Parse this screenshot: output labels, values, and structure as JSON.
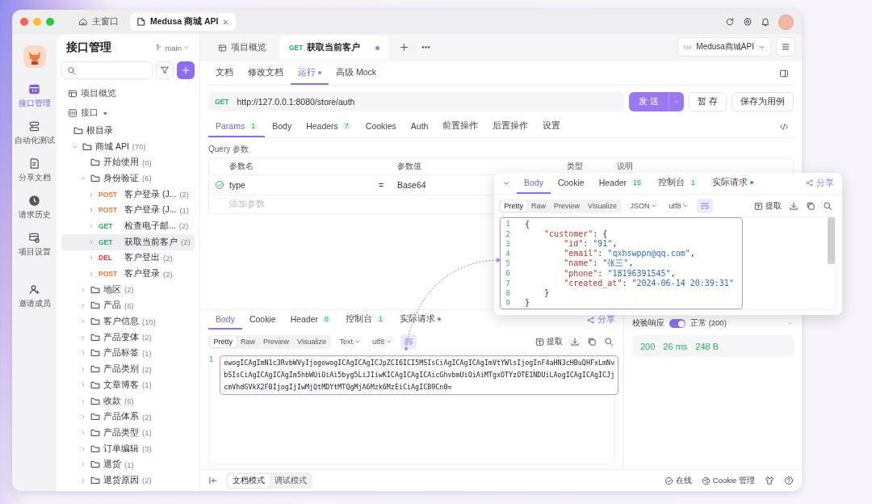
{
  "titlebar": {
    "tabs": [
      {
        "kind": "home",
        "label": "主窗口",
        "selected": false
      },
      {
        "kind": "project",
        "label": "Medusa 商城 API",
        "selected": true
      }
    ]
  },
  "rail": {
    "items": [
      {
        "kind": "api",
        "label": "接口管理",
        "selected": true
      },
      {
        "kind": "test",
        "label": "自动化测试",
        "selected": false
      },
      {
        "kind": "doc",
        "label": "分享文档",
        "selected": false
      },
      {
        "kind": "history",
        "label": "请求历史",
        "selected": false
      },
      {
        "kind": "settings",
        "label": "项目设置",
        "selected": false
      },
      {
        "kind": "invite",
        "label": "邀请成员",
        "selected": false
      }
    ]
  },
  "sidebar": {
    "title": "接口管理",
    "branch": "main",
    "overview": "项目概览",
    "section": "接口",
    "tree": [
      {
        "kind": "root",
        "label": "根目录",
        "selected": false
      },
      {
        "kind": "folder",
        "label": "商城 API",
        "count": "(70)",
        "expanded": true,
        "selected": false,
        "children": [
          {
            "kind": "plain-folder",
            "label": "开始使用",
            "count": "(0)",
            "selected": false
          },
          {
            "kind": "folder",
            "label": "身份验证",
            "count": "(6)",
            "expanded": true,
            "selected": false,
            "children": [
              {
                "kind": "endpoint",
                "method": "POST",
                "color": "#f5782f",
                "label": "客户登录 (J...",
                "count": "(2)",
                "expanded": false,
                "selected": false
              },
              {
                "kind": "endpoint",
                "method": "POST",
                "color": "#f5782f",
                "label": "客户登录 (J...",
                "count": "(1)",
                "expanded": false,
                "selected": false
              },
              {
                "kind": "endpoint",
                "method": "GET",
                "color": "#22b35e",
                "label": "检查电子邮...",
                "count": "(2)",
                "expanded": false,
                "selected": false
              },
              {
                "kind": "endpoint",
                "method": "GET",
                "color": "#22b35e",
                "label": "获取当前客户",
                "count": "(2)",
                "expanded": false,
                "selected": true
              },
              {
                "kind": "endpoint",
                "method": "DEL",
                "color": "#ee3b3b",
                "label": "客户登出",
                "count": "(2)",
                "expanded": false,
                "selected": false
              },
              {
                "kind": "endpoint",
                "method": "POST",
                "color": "#f5782f",
                "label": "客户登录",
                "count": "(2)",
                "expanded": false,
                "selected": false
              }
            ]
          },
          {
            "kind": "folder",
            "label": "地区",
            "count": "(2)",
            "expanded": false,
            "selected": false
          },
          {
            "kind": "folder",
            "label": "产品",
            "count": "(6)",
            "expanded": false,
            "selected": false
          },
          {
            "kind": "folder",
            "label": "客户信息",
            "count": "(10)",
            "expanded": false,
            "selected": false
          },
          {
            "kind": "folder",
            "label": "产品变体",
            "count": "(2)",
            "expanded": false,
            "selected": false
          },
          {
            "kind": "folder",
            "label": "产品标签",
            "count": "(1)",
            "expanded": false,
            "selected": false
          },
          {
            "kind": "folder",
            "label": "产品类别",
            "count": "(2)",
            "expanded": false,
            "selected": false
          },
          {
            "kind": "folder",
            "label": "文章博客",
            "count": "(1)",
            "expanded": false,
            "selected": false
          },
          {
            "kind": "folder",
            "label": "收款",
            "count": "(6)",
            "expanded": false,
            "selected": false
          },
          {
            "kind": "folder",
            "label": "产品体系",
            "count": "(2)",
            "expanded": false,
            "selected": false
          },
          {
            "kind": "folder",
            "label": "产品类型",
            "count": "(1)",
            "expanded": false,
            "selected": false
          },
          {
            "kind": "folder",
            "label": "订单编辑",
            "count": "(3)",
            "expanded": false,
            "selected": false
          },
          {
            "kind": "folder",
            "label": "退货",
            "count": "(1)",
            "expanded": false,
            "selected": false
          },
          {
            "kind": "folder",
            "label": "退货原因",
            "count": "(2)",
            "expanded": false,
            "selected": false
          }
        ]
      }
    ]
  },
  "main_tabs": [
    {
      "kind": "overview",
      "label": "项目概览",
      "selected": false,
      "unsaved": false
    },
    {
      "kind": "request",
      "method": "GET",
      "label": "获取当前客户",
      "selected": true,
      "unsaved": true
    }
  ],
  "project_switcher": {
    "badge": "Me",
    "label": "Medusa商城API"
  },
  "sub_tabs": [
    {
      "label": "文档",
      "selected": false,
      "dot": false
    },
    {
      "label": "修改文档",
      "selected": false,
      "dot": false
    },
    {
      "label": "运行",
      "selected": true,
      "dot": true
    },
    {
      "label": "高级 Mock",
      "selected": false,
      "dot": false
    }
  ],
  "request": {
    "method": "GET",
    "url": "http://127.0.0.1:8080/store/auth",
    "send": "发 送",
    "save": "暂 存",
    "save_case": "保存为用例"
  },
  "param_tabs": [
    {
      "label": "Params",
      "badge": "1",
      "selected": true
    },
    {
      "label": "Body",
      "selected": false
    },
    {
      "label": "Headers",
      "badge": "7",
      "selected": false
    },
    {
      "label": "Cookies",
      "selected": false
    },
    {
      "label": "Auth",
      "selected": false
    },
    {
      "label": "前置操作",
      "selected": false
    },
    {
      "label": "后置操作",
      "selected": false
    },
    {
      "label": "设置",
      "selected": false
    }
  ],
  "query": {
    "title": "Query 参数",
    "columns": [
      "参数名",
      "参数值",
      "类型",
      "说明"
    ],
    "rows": [
      {
        "checked": true,
        "name": "type",
        "operator": "=",
        "value": "Base64"
      }
    ],
    "placeholder": "添加参数"
  },
  "response": {
    "tabs": [
      {
        "label": "Body",
        "selected": true,
        "dot": false
      },
      {
        "label": "Cookie",
        "selected": false,
        "dot": false
      },
      {
        "label": "Header",
        "badge": "8",
        "selected": false,
        "dot": false
      },
      {
        "label": "控制台",
        "badge": "1",
        "selected": false,
        "dot": false
      },
      {
        "label": "实际请求",
        "selected": false,
        "dot": true
      }
    ],
    "share": "分享",
    "formats": [
      {
        "label": "Pretty",
        "selected": true
      },
      {
        "label": "Raw",
        "selected": false
      },
      {
        "label": "Preview",
        "selected": false
      },
      {
        "label": "Visualize",
        "selected": false
      }
    ],
    "dropdowns": [
      "Text",
      "utf8"
    ],
    "wrap": true,
    "extract": "提取",
    "highlight": true,
    "lines": [
      {
        "number": "1",
        "text": "ewogICAgImN1c3RvbWVyIjogewogICAgICAgICJpZCI6ICI5MSIsCiAgICAgICAgImVtYWlsIjogInF4aHN3cHBuQHFxLmNvbSIsCiAgICAgICAgIm5hbWUiOiAi5byg5LiJIiwKICAgICAgICAicGhvbmUiOiAiMTgxOTYzOTE1NDUiLAogICAgICAgICJjcmVhdGVkX2F0IjogIjIwMjQtMDYtMTQgMjA6Mzk6MzEiCiAgICB9Cn0="
      }
    ]
  },
  "validation": {
    "label": "校验响应",
    "on": true,
    "status": "正常 (200)",
    "stats": [
      "200",
      "26 ms",
      "248 B"
    ]
  },
  "status_bar": {
    "modes": [
      {
        "label": "文档模式",
        "selected": true
      },
      {
        "label": "调试模式",
        "selected": false
      }
    ],
    "online": "在线",
    "cookie": "Cookie 管理"
  },
  "popup": {
    "tabs": [
      {
        "label": "Body",
        "selected": true,
        "dot": false
      },
      {
        "label": "Cookie",
        "selected": false,
        "dot": false
      },
      {
        "label": "Header",
        "badge": "15",
        "selected": false,
        "dot": false
      },
      {
        "label": "控制台",
        "badge": "1",
        "selected": false,
        "dot": false
      },
      {
        "label": "实际请求",
        "selected": false,
        "dot": true
      }
    ],
    "share": "分享",
    "formats": [
      {
        "label": "Pretty",
        "selected": true
      },
      {
        "label": "Raw",
        "selected": false
      },
      {
        "label": "Preview",
        "selected": false
      },
      {
        "label": "Visualize",
        "selected": false
      }
    ],
    "dropdowns": [
      "JSON",
      "utf8"
    ],
    "wrap": true,
    "extract": "提取",
    "highlight": true,
    "lines": [
      {
        "number": "1",
        "tokens": [
          {
            "kind": "punct",
            "text": "{"
          }
        ]
      },
      {
        "number": "2",
        "tokens": [
          {
            "kind": "key",
            "text": "    \"customer\""
          },
          {
            "kind": "punct",
            "text": ": {"
          }
        ]
      },
      {
        "number": "3",
        "tokens": [
          {
            "kind": "key",
            "text": "        \"id\""
          },
          {
            "kind": "punct",
            "text": ": "
          },
          {
            "kind": "string",
            "text": "\"91\""
          },
          {
            "kind": "punct",
            "text": ","
          }
        ]
      },
      {
        "number": "4",
        "tokens": [
          {
            "kind": "key",
            "text": "        \"email\""
          },
          {
            "kind": "punct",
            "text": ": "
          },
          {
            "kind": "string",
            "text": "\"qxhswppn@qq.com\""
          },
          {
            "kind": "punct",
            "text": ","
          }
        ]
      },
      {
        "number": "5",
        "tokens": [
          {
            "kind": "key",
            "text": "        \"name\""
          },
          {
            "kind": "punct",
            "text": ": "
          },
          {
            "kind": "string",
            "text": "\"张三\""
          },
          {
            "kind": "punct",
            "text": ","
          }
        ]
      },
      {
        "number": "6",
        "tokens": [
          {
            "kind": "key",
            "text": "        \"phone\""
          },
          {
            "kind": "punct",
            "text": ": "
          },
          {
            "kind": "string",
            "text": "\"18196391545\""
          },
          {
            "kind": "punct",
            "text": ","
          }
        ]
      },
      {
        "number": "7",
        "tokens": [
          {
            "kind": "key",
            "text": "        \"created_at\""
          },
          {
            "kind": "punct",
            "text": ": "
          },
          {
            "kind": "string",
            "text": "\"2024-06-14 20:39:31\""
          }
        ]
      },
      {
        "number": "8",
        "tokens": [
          {
            "kind": "punct",
            "text": "    }"
          }
        ]
      },
      {
        "number": "9",
        "tokens": [
          {
            "kind": "punct",
            "text": "}"
          }
        ]
      }
    ]
  }
}
